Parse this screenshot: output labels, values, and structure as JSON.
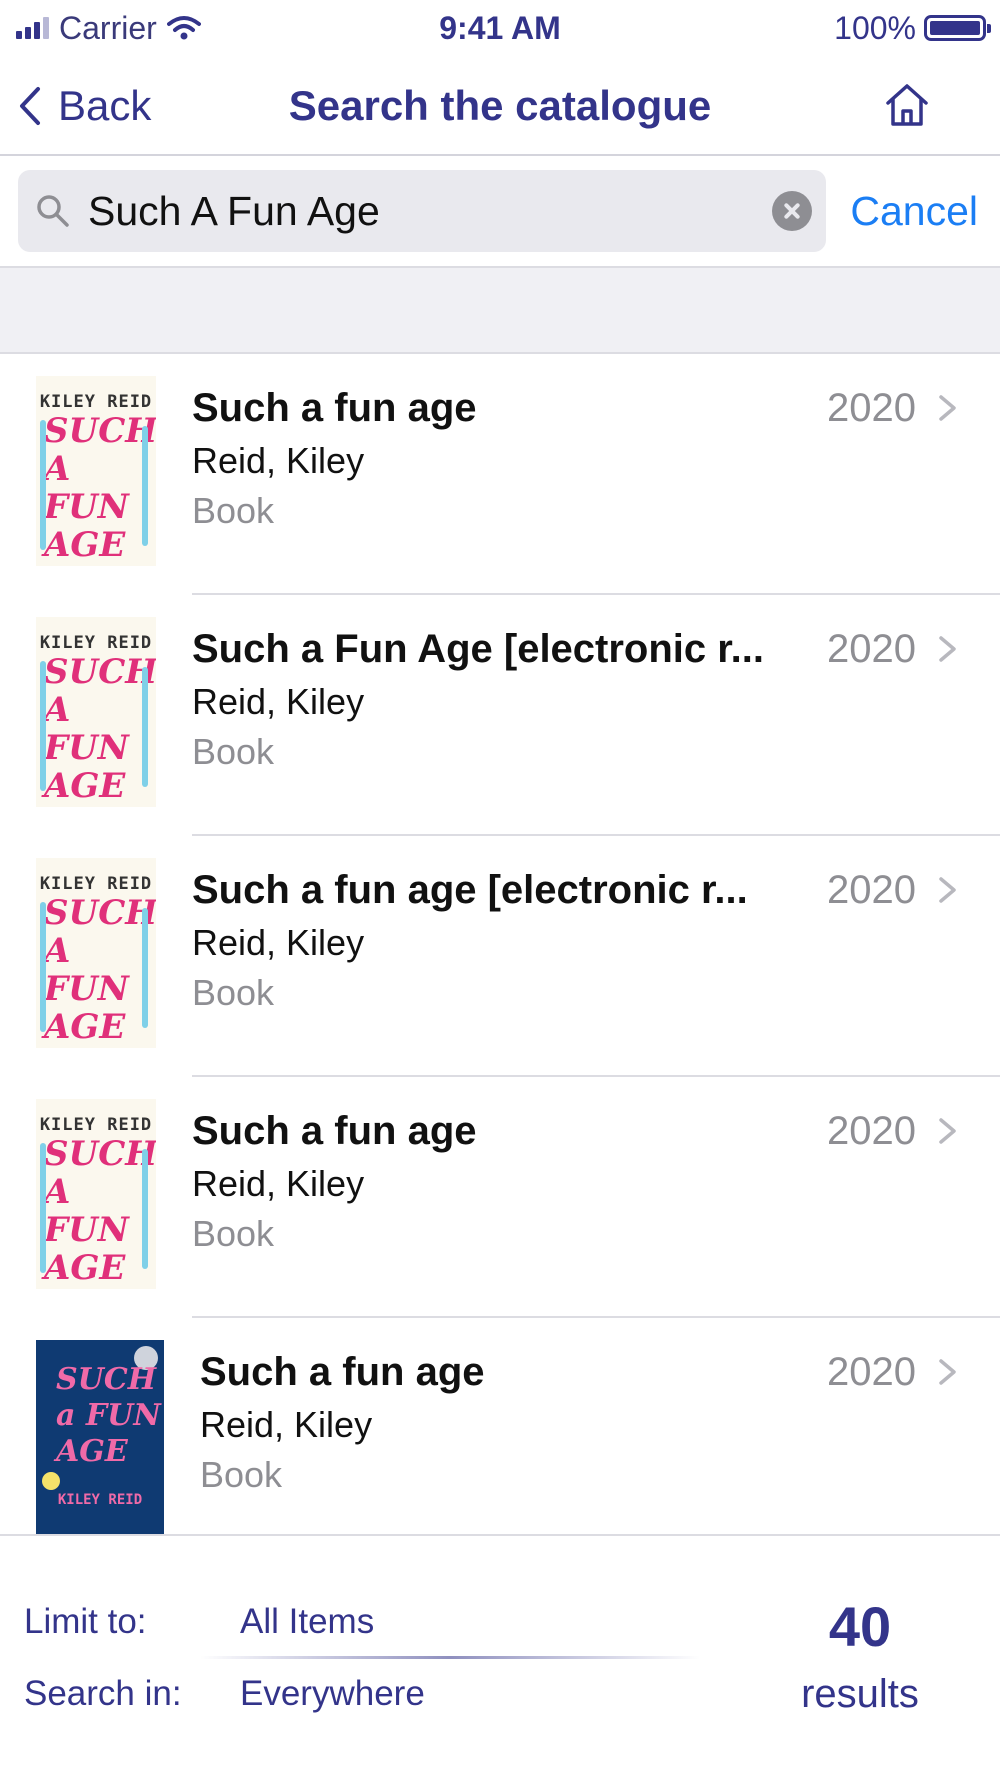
{
  "status_bar": {
    "carrier": "Carrier",
    "time": "9:41 AM",
    "battery": "100%"
  },
  "nav": {
    "back_label": "Back",
    "title": "Search the catalogue",
    "home_icon": "home-icon"
  },
  "search": {
    "value": "Such A Fun Age",
    "cancel_label": "Cancel"
  },
  "results": [
    {
      "title": "Such a fun age",
      "author": "Reid, Kiley",
      "format": "Book",
      "year": "2020",
      "cover": "light"
    },
    {
      "title": "Such a Fun Age [electronic r...",
      "author": "Reid, Kiley",
      "format": "Book",
      "year": "2020",
      "cover": "light"
    },
    {
      "title": "Such a fun age [electronic r...",
      "author": "Reid, Kiley",
      "format": "Book",
      "year": "2020",
      "cover": "light"
    },
    {
      "title": "Such a fun age",
      "author": "Reid, Kiley",
      "format": "Book",
      "year": "2020",
      "cover": "light"
    },
    {
      "title": "Such a fun age",
      "author": "Reid, Kiley",
      "format": "Book",
      "year": "2020",
      "cover": "dark"
    }
  ],
  "covers": {
    "light_author": "KILEY REID",
    "light_title": "SUCH A FUN AGE",
    "dark_title": "SUCH a FUN AGE",
    "dark_author": "KILEY REID"
  },
  "filters": {
    "limit_label": "Limit to:",
    "limit_value": "All Items",
    "search_label": "Search in:",
    "search_value": "Everywhere"
  },
  "result_count": {
    "value": "40",
    "label": "results"
  },
  "colors": {
    "brand": "#33348a",
    "link": "#1b7ef4",
    "muted": "#8e8e93"
  }
}
